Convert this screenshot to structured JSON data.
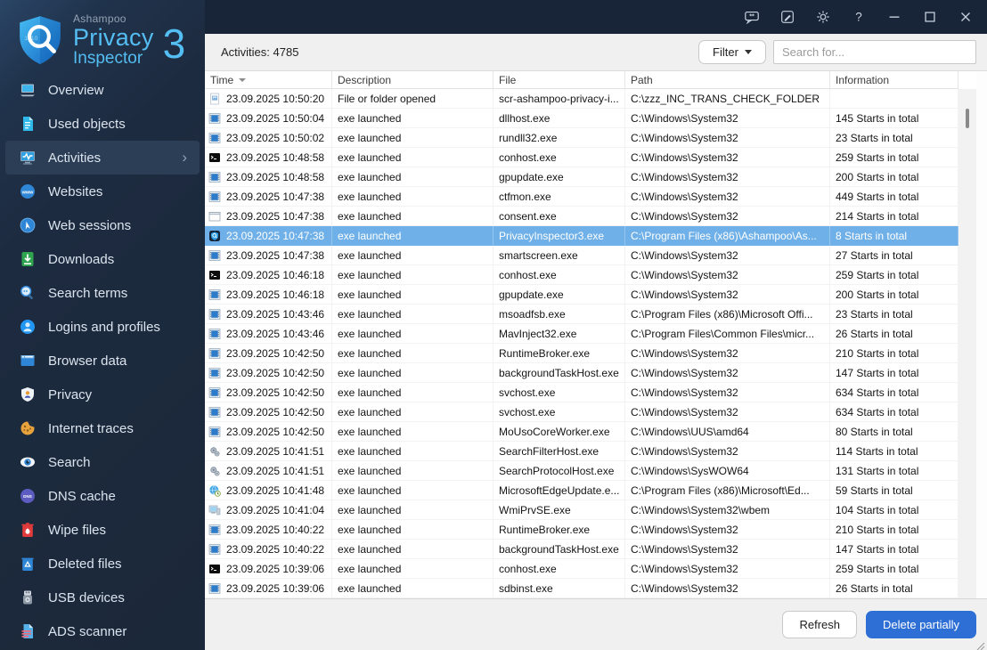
{
  "titlebar": {
    "icons": [
      "feedback",
      "notes",
      "settings",
      "help",
      "minimize",
      "maximize",
      "close"
    ]
  },
  "logo": {
    "company": "Ashampoo",
    "product_line1": "Privacy",
    "product_line2": "Inspector",
    "version": "3"
  },
  "sidebar": {
    "items": [
      {
        "id": "overview",
        "label": "Overview",
        "icon": "overview",
        "selected": false
      },
      {
        "id": "used-objects",
        "label": "Used objects",
        "icon": "used-objects",
        "selected": false
      },
      {
        "id": "activities",
        "label": "Activities",
        "icon": "activities",
        "selected": true
      },
      {
        "id": "websites",
        "label": "Websites",
        "icon": "websites",
        "selected": false
      },
      {
        "id": "web-sessions",
        "label": "Web sessions",
        "icon": "web-sessions",
        "selected": false
      },
      {
        "id": "downloads",
        "label": "Downloads",
        "icon": "downloads",
        "selected": false
      },
      {
        "id": "search-terms",
        "label": "Search terms",
        "icon": "search-terms",
        "selected": false
      },
      {
        "id": "logins-and-profiles",
        "label": "Logins and profiles",
        "icon": "logins",
        "selected": false
      },
      {
        "id": "browser-data",
        "label": "Browser data",
        "icon": "browser-data",
        "selected": false
      },
      {
        "id": "privacy",
        "label": "Privacy",
        "icon": "privacy",
        "selected": false
      },
      {
        "id": "internet-traces",
        "label": "Internet traces",
        "icon": "internet-traces",
        "selected": false
      },
      {
        "id": "search",
        "label": "Search",
        "icon": "search",
        "selected": false
      },
      {
        "id": "dns-cache",
        "label": "DNS cache",
        "icon": "dns-cache",
        "selected": false
      },
      {
        "id": "wipe-files",
        "label": "Wipe files",
        "icon": "wipe-files",
        "selected": false
      },
      {
        "id": "deleted-files",
        "label": "Deleted files",
        "icon": "deleted-files",
        "selected": false
      },
      {
        "id": "usb-devices",
        "label": "USB devices",
        "icon": "usb-devices",
        "selected": false
      },
      {
        "id": "ads-scanner",
        "label": "ADS scanner",
        "icon": "ads-scanner",
        "selected": false
      }
    ]
  },
  "header": {
    "activities_count": "Activities: 4785",
    "filter_label": "Filter",
    "search_placeholder": "Search for..."
  },
  "table": {
    "columns": [
      {
        "id": "time",
        "label": "Time",
        "sort": "desc"
      },
      {
        "id": "description",
        "label": "Description",
        "sort": ""
      },
      {
        "id": "file",
        "label": "File",
        "sort": ""
      },
      {
        "id": "path",
        "label": "Path",
        "sort": ""
      },
      {
        "id": "information",
        "label": "Information",
        "sort": ""
      }
    ],
    "rows": [
      {
        "icon": "file",
        "time": "23.09.2025 10:50:20",
        "description": "File or folder opened",
        "file": "scr-ashampoo-privacy-i...",
        "path": "C:\\zzz_INC_TRANS_CHECK_FOLDER",
        "info": "",
        "selected": false
      },
      {
        "icon": "app",
        "time": "23.09.2025 10:50:04",
        "description": "exe launched",
        "file": "dllhost.exe",
        "path": "C:\\Windows\\System32",
        "info": "145 Starts in total",
        "selected": false
      },
      {
        "icon": "app",
        "time": "23.09.2025 10:50:02",
        "description": "exe launched",
        "file": "rundll32.exe",
        "path": "C:\\Windows\\System32",
        "info": "23 Starts in total",
        "selected": false
      },
      {
        "icon": "console",
        "time": "23.09.2025 10:48:58",
        "description": "exe launched",
        "file": "conhost.exe",
        "path": "C:\\Windows\\System32",
        "info": "259 Starts in total",
        "selected": false
      },
      {
        "icon": "app",
        "time": "23.09.2025 10:48:58",
        "description": "exe launched",
        "file": "gpupdate.exe",
        "path": "C:\\Windows\\System32",
        "info": "200 Starts in total",
        "selected": false
      },
      {
        "icon": "app",
        "time": "23.09.2025 10:47:38",
        "description": "exe launched",
        "file": "ctfmon.exe",
        "path": "C:\\Windows\\System32",
        "info": "449 Starts in total",
        "selected": false
      },
      {
        "icon": "window",
        "time": "23.09.2025 10:47:38",
        "description": "exe launched",
        "file": "consent.exe",
        "path": "C:\\Windows\\System32",
        "info": "214 Starts in total",
        "selected": false
      },
      {
        "icon": "privacy-app",
        "time": "23.09.2025 10:47:38",
        "description": "exe launched",
        "file": "PrivacyInspector3.exe",
        "path": "C:\\Program Files (x86)\\Ashampoo\\As...",
        "info": "8 Starts in total",
        "selected": true
      },
      {
        "icon": "app",
        "time": "23.09.2025 10:47:38",
        "description": "exe launched",
        "file": "smartscreen.exe",
        "path": "C:\\Windows\\System32",
        "info": "27 Starts in total",
        "selected": false
      },
      {
        "icon": "console",
        "time": "23.09.2025 10:46:18",
        "description": "exe launched",
        "file": "conhost.exe",
        "path": "C:\\Windows\\System32",
        "info": "259 Starts in total",
        "selected": false
      },
      {
        "icon": "app",
        "time": "23.09.2025 10:46:18",
        "description": "exe launched",
        "file": "gpupdate.exe",
        "path": "C:\\Windows\\System32",
        "info": "200 Starts in total",
        "selected": false
      },
      {
        "icon": "app",
        "time": "23.09.2025 10:43:46",
        "description": "exe launched",
        "file": "msoadfsb.exe",
        "path": "C:\\Program Files (x86)\\Microsoft Offi...",
        "info": "23 Starts in total",
        "selected": false
      },
      {
        "icon": "app",
        "time": "23.09.2025 10:43:46",
        "description": "exe launched",
        "file": "MavInject32.exe",
        "path": "C:\\Program Files\\Common Files\\micr...",
        "info": "26 Starts in total",
        "selected": false
      },
      {
        "icon": "app",
        "time": "23.09.2025 10:42:50",
        "description": "exe launched",
        "file": "RuntimeBroker.exe",
        "path": "C:\\Windows\\System32",
        "info": "210 Starts in total",
        "selected": false
      },
      {
        "icon": "app",
        "time": "23.09.2025 10:42:50",
        "description": "exe launched",
        "file": "backgroundTaskHost.exe",
        "path": "C:\\Windows\\System32",
        "info": "147 Starts in total",
        "selected": false
      },
      {
        "icon": "app",
        "time": "23.09.2025 10:42:50",
        "description": "exe launched",
        "file": "svchost.exe",
        "path": "C:\\Windows\\System32",
        "info": "634 Starts in total",
        "selected": false
      },
      {
        "icon": "app",
        "time": "23.09.2025 10:42:50",
        "description": "exe launched",
        "file": "svchost.exe",
        "path": "C:\\Windows\\System32",
        "info": "634 Starts in total",
        "selected": false
      },
      {
        "icon": "app",
        "time": "23.09.2025 10:42:50",
        "description": "exe launched",
        "file": "MoUsoCoreWorker.exe",
        "path": "C:\\Windows\\UUS\\amd64",
        "info": "80 Starts in total",
        "selected": false
      },
      {
        "icon": "gear",
        "time": "23.09.2025 10:41:51",
        "description": "exe launched",
        "file": "SearchFilterHost.exe",
        "path": "C:\\Windows\\System32",
        "info": "114 Starts in total",
        "selected": false
      },
      {
        "icon": "gear",
        "time": "23.09.2025 10:41:51",
        "description": "exe launched",
        "file": "SearchProtocolHost.exe",
        "path": "C:\\Windows\\SysWOW64",
        "info": "131 Starts in total",
        "selected": false
      },
      {
        "icon": "globe",
        "time": "23.09.2025 10:41:48",
        "description": "exe launched",
        "file": "MicrosoftEdgeUpdate.e...",
        "path": "C:\\Program Files (x86)\\Microsoft\\Ed...",
        "info": "59 Starts in total",
        "selected": false
      },
      {
        "icon": "computer",
        "time": "23.09.2025 10:41:04",
        "description": "exe launched",
        "file": "WmiPrvSE.exe",
        "path": "C:\\Windows\\System32\\wbem",
        "info": "104 Starts in total",
        "selected": false
      },
      {
        "icon": "app",
        "time": "23.09.2025 10:40:22",
        "description": "exe launched",
        "file": "RuntimeBroker.exe",
        "path": "C:\\Windows\\System32",
        "info": "210 Starts in total",
        "selected": false
      },
      {
        "icon": "app",
        "time": "23.09.2025 10:40:22",
        "description": "exe launched",
        "file": "backgroundTaskHost.exe",
        "path": "C:\\Windows\\System32",
        "info": "147 Starts in total",
        "selected": false
      },
      {
        "icon": "console",
        "time": "23.09.2025 10:39:06",
        "description": "exe launched",
        "file": "conhost.exe",
        "path": "C:\\Windows\\System32",
        "info": "259 Starts in total",
        "selected": false
      },
      {
        "icon": "app",
        "time": "23.09.2025 10:39:06",
        "description": "exe launched",
        "file": "sdbinst.exe",
        "path": "C:\\Windows\\System32",
        "info": "26 Starts in total",
        "selected": false
      }
    ]
  },
  "footer": {
    "refresh_label": "Refresh",
    "delete_label": "Delete partially"
  },
  "colors": {
    "accent_blue": "#2e6fd6",
    "selection_blue": "#6fb0e8",
    "sidebar_bg": "#1d2b40",
    "titlebar_bg": "#182538",
    "logo_blue": "#54bdf2"
  }
}
